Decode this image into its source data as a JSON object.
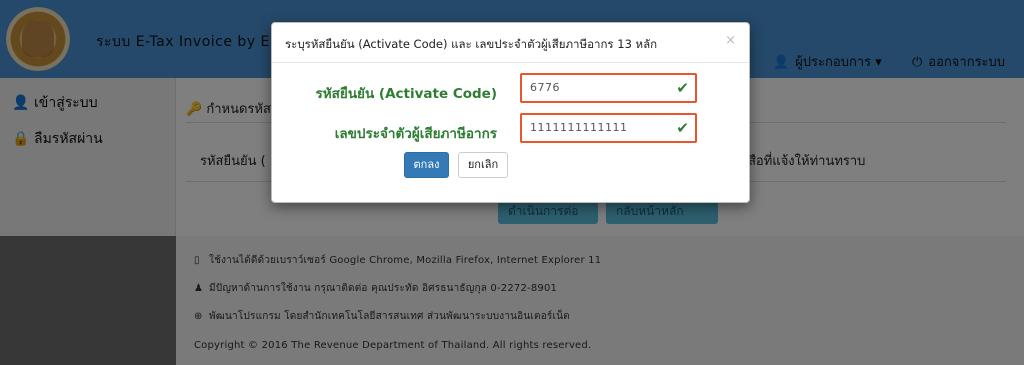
{
  "navbar": {
    "brand": "ระบบ E-Tax Invoice by Em",
    "user_menu": "ผู้ประกอบการ ▾",
    "logout": "ออกจากระบบ",
    "color": "#4a93d6"
  },
  "sidebar": {
    "items": [
      {
        "label": "เข้าสู่ระบบ",
        "icon": "user-icon"
      },
      {
        "label": "ลืมรหัสผ่าน",
        "icon": "lock-icon"
      }
    ]
  },
  "content": {
    "panel_title": "กำหนดรหัสผ",
    "row_left": "รหัสยืนยัน (",
    "row_right": "สือที่แจ้งให้ท่านทราบ",
    "buttons": [
      "ดำเนินการต่อ",
      "กลับหน้าหลัก"
    ]
  },
  "footer": {
    "lines": [
      {
        "icon": "mobile-icon",
        "text": "ใช้งานได้ดีด้วยเบราว์เซอร์ Google Chrome, Mozilla Firefox, Internet Explorer 11"
      },
      {
        "icon": "person-icon",
        "text": "มีปัญหาด้านการใช้งาน กรุณาติดต่อ คุณประทัด อิศรธนาธัญกุล 0-2272-8901"
      },
      {
        "icon": "globe-icon",
        "text": "พัฒนาโปรแกรม โดยสำนักเทคโนโลยีสารสนเทศ ส่วนพัฒนาระบบงานอินเตอร์เน็ต"
      },
      {
        "icon": "",
        "text": "Copyright © 2016 The Revenue Department of Thailand. All rights reserved."
      }
    ]
  },
  "modal": {
    "title": "ระบุรหัสยืนยัน (Activate Code) และ เลขประจำตัวผู้เสียภาษีอากร 13 หลัก",
    "close": "×",
    "fields": [
      {
        "label": "รหัสยืนยัน (Activate Code)",
        "value": "6776"
      },
      {
        "label": "เลขประจำตัวผู้เสียภาษีอากร",
        "value": "1111111111111"
      }
    ],
    "ok_label": "ตกลง",
    "cancel_label": "ยกเลิก",
    "accent": "#e8562a",
    "valid_color": "#2e7d32"
  }
}
